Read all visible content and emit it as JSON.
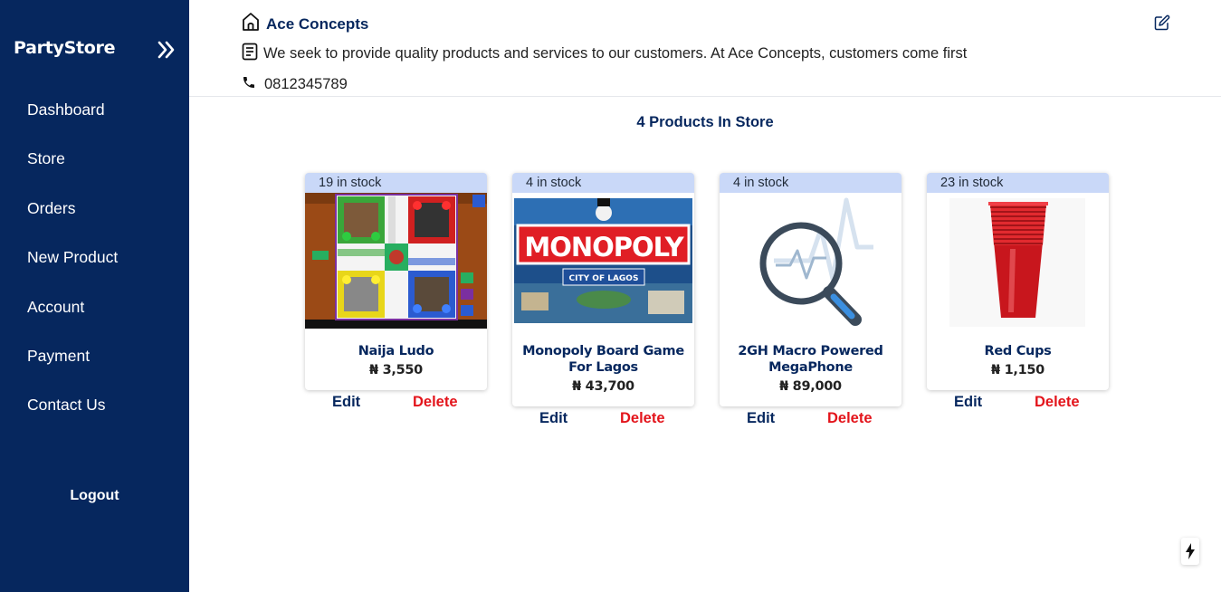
{
  "sidebar": {
    "brand": "PartyStore",
    "items": [
      {
        "label": "Dashboard"
      },
      {
        "label": "Store"
      },
      {
        "label": "Orders"
      },
      {
        "label": "New Product"
      },
      {
        "label": "Account"
      },
      {
        "label": "Payment"
      },
      {
        "label": "Contact Us"
      }
    ],
    "logout": "Logout"
  },
  "store": {
    "name": "Ace Concepts",
    "description": "We seek to provide quality products and services to our customers. At Ace Concepts, customers come first",
    "phone": "0812345789"
  },
  "main": {
    "title": "4 Products In Store",
    "products": [
      {
        "stock": "19 in stock",
        "name": "Naija Ludo",
        "price": "₦ 3,550",
        "edit": "Edit",
        "delete": "Delete"
      },
      {
        "stock": "4 in stock",
        "name": "Monopoly Board Game For Lagos",
        "price": "₦ 43,700",
        "edit": "Edit",
        "delete": "Delete",
        "image_text": "MONOPOLY",
        "image_subtext": "CITY OF LAGOS"
      },
      {
        "stock": "4 in stock",
        "name": "2GH Macro Powered MegaPhone",
        "price": "₦ 89,000",
        "edit": "Edit",
        "delete": "Delete"
      },
      {
        "stock": "23 in stock",
        "name": "Red Cups",
        "price": "₦ 1,150",
        "edit": "Edit",
        "delete": "Delete"
      }
    ]
  },
  "colors": {
    "sidebar_bg": "#06275e",
    "stock_badge_bg": "#c9d8f8",
    "delete_red": "#e3141b"
  },
  "icons": [
    "chevrons-right-icon",
    "home-icon",
    "document-icon",
    "phone-icon",
    "edit-icon",
    "flash-icon"
  ]
}
